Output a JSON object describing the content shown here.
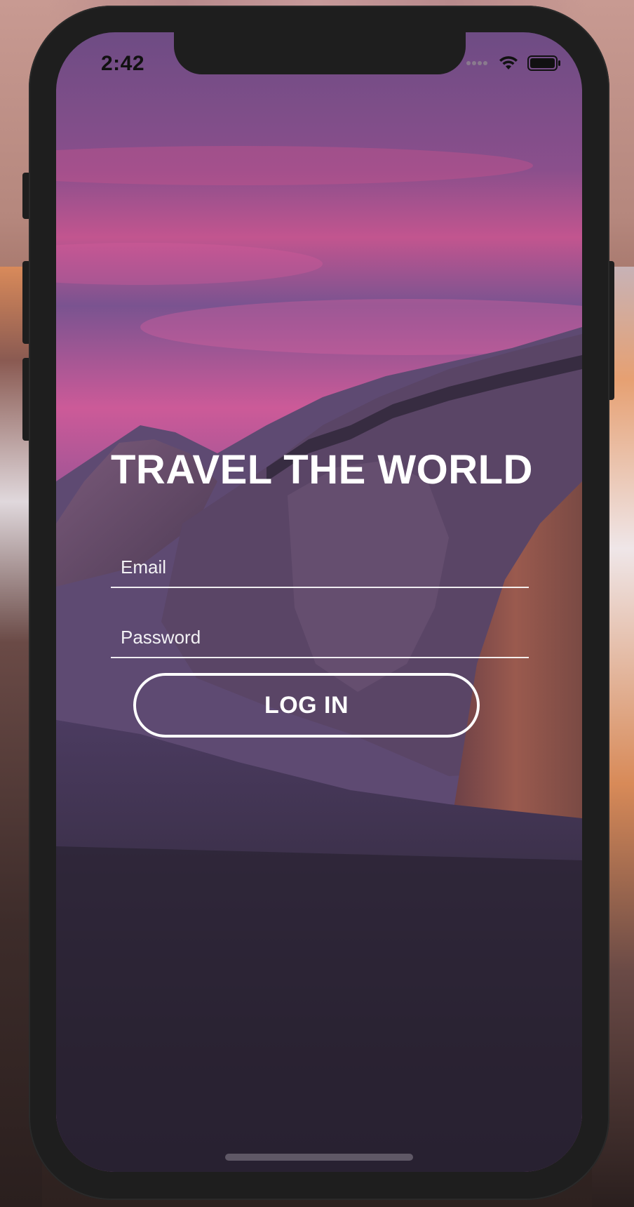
{
  "status_bar": {
    "time": "2:42",
    "icons": [
      "signal-dots-icon",
      "wifi-icon",
      "battery-icon"
    ]
  },
  "login": {
    "title": "TRAVEL THE WORLD",
    "email_placeholder": "Email",
    "password_placeholder": "Password",
    "login_button_label": "LOG IN"
  },
  "colors": {
    "text": "#ffffff",
    "sky_top": "#7a4f86",
    "sky_pink": "#d3599a",
    "mountain": "#4d3a5e",
    "forest": "#2a2433",
    "bezel": "#1e1e1e"
  }
}
